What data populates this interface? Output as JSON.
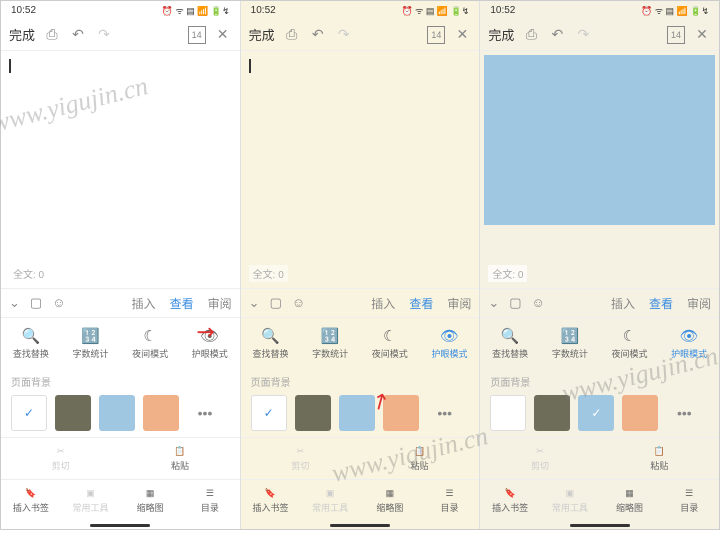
{
  "status": {
    "time": "10:52",
    "icons": "⏰ ᯤ ▤ 📶 🔋↯"
  },
  "toolbar": {
    "done": "完成",
    "page_badge": "14"
  },
  "editor": {
    "word_count": "全文: 0"
  },
  "tabs": {
    "insert": "插入",
    "view": "查看",
    "review": "审阅"
  },
  "actions": {
    "find_replace": "查找替换",
    "word_count": "字数统计",
    "night_mode": "夜间模式",
    "eye_mode": "护眼模式"
  },
  "bg_section": {
    "label": "页面背景",
    "more": "•••"
  },
  "clipboard": {
    "cut": "剪切",
    "paste": "粘贴"
  },
  "bottom": {
    "bookmark": "插入书签",
    "tools": "常用工具",
    "thumbnail": "缩略图",
    "toc": "目录"
  },
  "watermark": "www.yigujin.cn"
}
